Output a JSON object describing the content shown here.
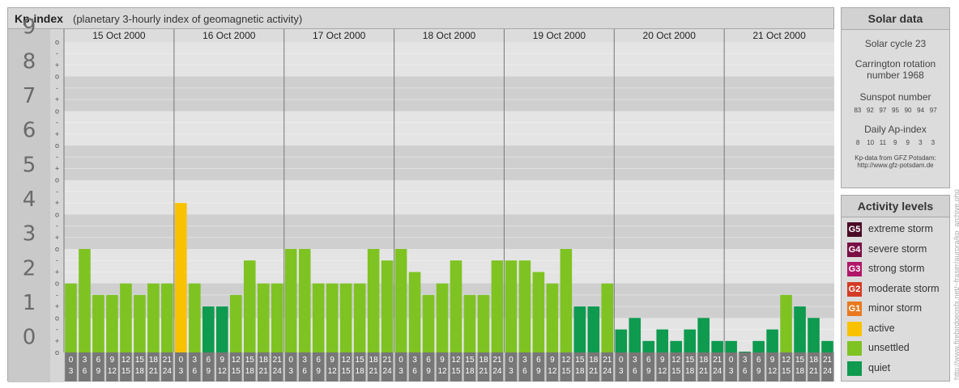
{
  "header": {
    "title": "Kp-index",
    "subtitle": "(planetary 3-hourly index of geomagnetic activity)"
  },
  "chart_data": {
    "type": "bar",
    "ylim": [
      0,
      9
    ],
    "y_major_ticks": [
      "0",
      "1",
      "2",
      "3",
      "4",
      "5",
      "6",
      "7",
      "8",
      "9"
    ],
    "y_minor_tick_symbols": [
      "-",
      "o",
      "+"
    ],
    "days": [
      "15 Oct 2000",
      "16 Oct 2000",
      "17 Oct 2000",
      "18 Oct 2000",
      "19 Oct 2000",
      "20 Oct 2000",
      "21 Oct 2000"
    ],
    "interval_labels": [
      [
        "0",
        "3"
      ],
      [
        "3",
        "6"
      ],
      [
        "6",
        "9"
      ],
      [
        "9",
        "12"
      ],
      [
        "12",
        "15"
      ],
      [
        "15",
        "18"
      ],
      [
        "18",
        "21"
      ],
      [
        "21",
        "24"
      ]
    ],
    "values": [
      [
        2,
        3,
        1.667,
        1.667,
        2,
        1.667,
        2,
        2
      ],
      [
        4.333,
        2,
        1.333,
        1.333,
        1.667,
        2.667,
        2,
        2
      ],
      [
        3,
        3,
        2,
        2,
        2,
        2,
        3,
        2.667
      ],
      [
        3,
        2.333,
        1.667,
        2,
        2.667,
        1.667,
        1.667,
        2.667
      ],
      [
        2.667,
        2.667,
        2.333,
        2,
        3,
        1.333,
        1.333,
        2
      ],
      [
        0.667,
        1,
        0.333,
        0.667,
        0.333,
        0.667,
        1,
        0.333
      ],
      [
        0.333,
        0,
        0.333,
        0.667,
        1.667,
        1.333,
        1,
        0.333
      ]
    ],
    "level_colors": {
      "quiet": "#0e9a4f",
      "unsettled": "#7ec322",
      "active": "#f9c200"
    },
    "grid": true
  },
  "solar_panel": {
    "title": "Solar data",
    "solar_cycle": "Solar cycle 23",
    "carrington_line1": "Carrington rotation",
    "carrington_line2": "number 1968",
    "sunspot_label": "Sunspot number",
    "sunspot_values": "83   92   97   95   90   94   97",
    "ap_label": "Daily Ap-index",
    "ap_values": "8    10   11    9     9     3     3",
    "source_line1": "Kp-data from GFZ Potsdam:",
    "source_line2": "http://www.gfz-potsdam.de"
  },
  "levels_panel": {
    "title": "Activity levels",
    "items": [
      {
        "code": "G5",
        "label": "extreme storm",
        "color": "#4a0a26"
      },
      {
        "code": "G4",
        "label": "severe storm",
        "color": "#7a0f45"
      },
      {
        "code": "G3",
        "label": "strong storm",
        "color": "#b0176a"
      },
      {
        "code": "G2",
        "label": "moderate storm",
        "color": "#d43a24"
      },
      {
        "code": "G1",
        "label": "minor storm",
        "color": "#e8791e"
      },
      {
        "code": "",
        "label": "active",
        "color": "#f9c200"
      },
      {
        "code": "",
        "label": "unsettled",
        "color": "#7ec322"
      },
      {
        "code": "",
        "label": "quiet",
        "color": "#0e9a4f"
      }
    ]
  },
  "watermark": "http://www.firebirdgeosfx.net/~fraser/aurora/kp_archive.php"
}
